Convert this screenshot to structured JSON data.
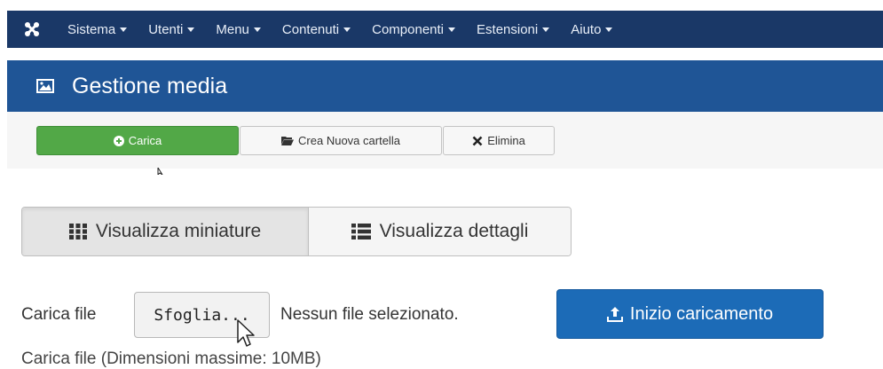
{
  "top_menu": {
    "logo_icon": "joomla-logo-icon",
    "items": [
      {
        "label": "Sistema"
      },
      {
        "label": "Utenti"
      },
      {
        "label": "Menu"
      },
      {
        "label": "Contenuti"
      },
      {
        "label": "Componenti"
      },
      {
        "label": "Estensioni"
      },
      {
        "label": "Aiuto"
      }
    ]
  },
  "header": {
    "title": "Gestione media",
    "icon": "image-icon"
  },
  "toolbar": {
    "upload_label": "Carica",
    "new_folder_label": "Crea Nuova cartella",
    "delete_label": "Elimina",
    "upload_color": "#52a847"
  },
  "view_toggle": {
    "thumbnails_label": "Visualizza miniature",
    "details_label": "Visualizza dettagli",
    "active": "thumbnails"
  },
  "upload_form": {
    "label": "Carica file",
    "browse_label": "Sfoglia...",
    "status": "Nessun file selezionato.",
    "start_label": "Inizio caricamento",
    "max_size_note": "Carica file (Dimensioni massime: 10MB)",
    "start_color": "#1c6bb7"
  }
}
